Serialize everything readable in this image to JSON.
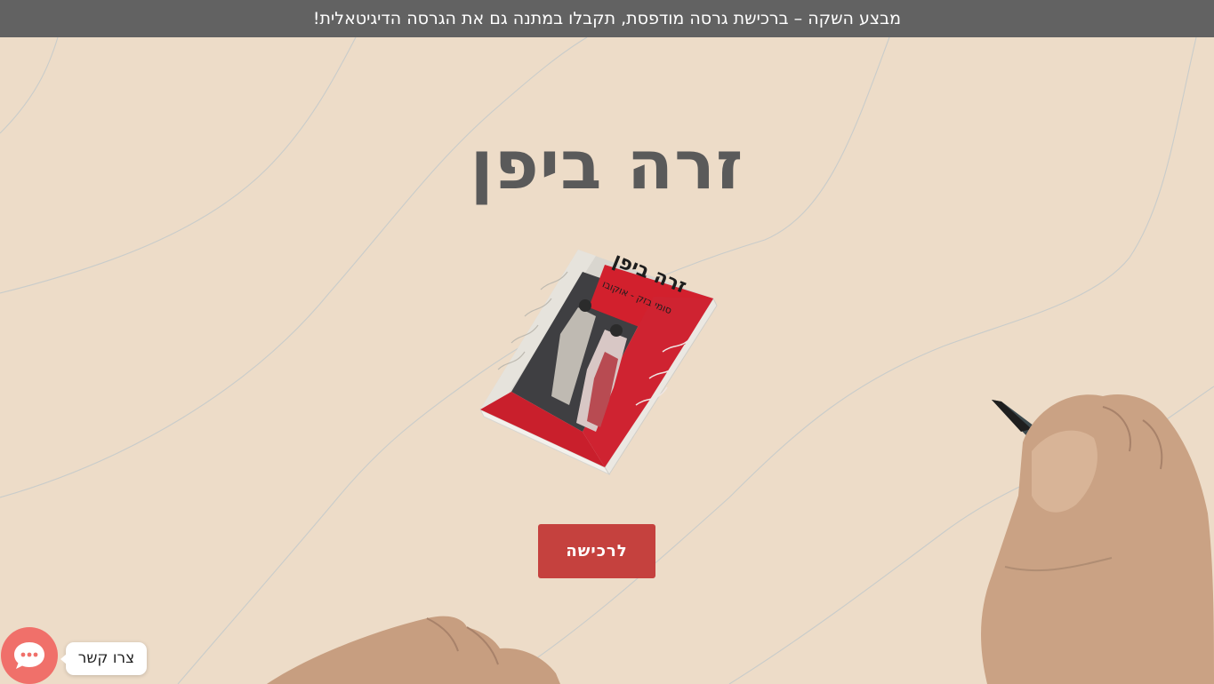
{
  "promo_bar": {
    "text": "מבצע השקה – ברכישת גרסה מודפסת, תקבלו במתנה גם את הגרסה הדיגיטאלית!"
  },
  "hero": {
    "title": "זרה ביפן",
    "buy_button_label": "לרכישה"
  },
  "book_cover": {
    "title": "זרה ביפן",
    "author": "סומי בזק - אוקובו"
  },
  "contact": {
    "label": "צרו קשר",
    "icon": "chat-bubble-icon"
  },
  "colors": {
    "background": "#eddcc8",
    "promo_bar": "#626262",
    "title": "#5a5a5a",
    "button": "#c5413e",
    "chat_button": "#f0706a"
  }
}
